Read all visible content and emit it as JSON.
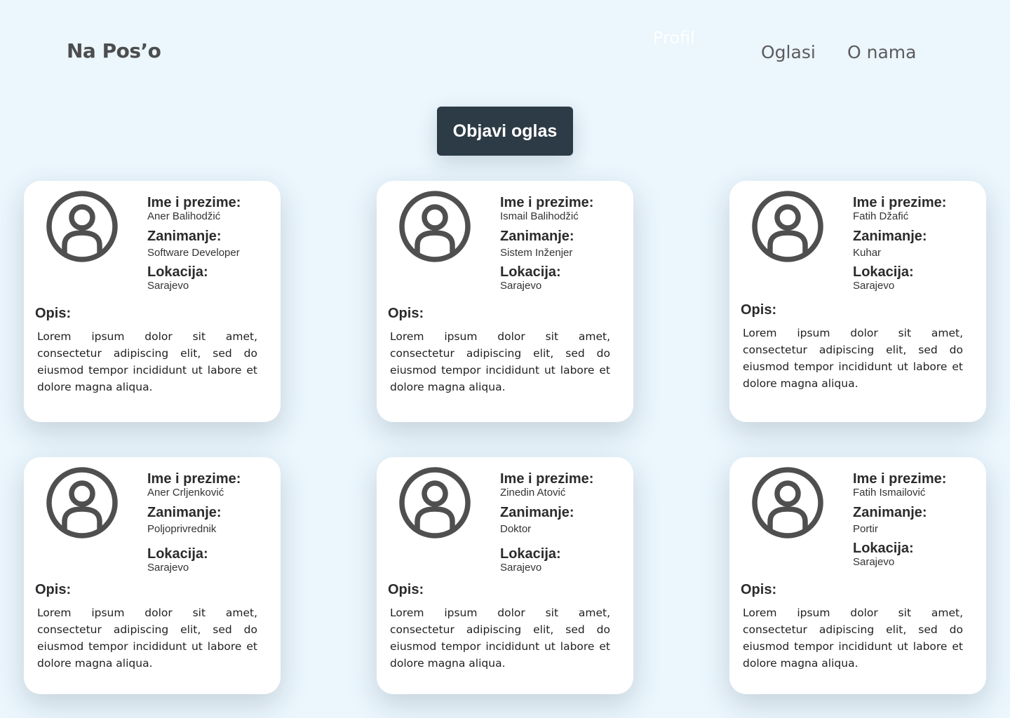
{
  "header": {
    "brand": "Na Pos’o",
    "nav": {
      "profil": "Profil",
      "oglasi": "Oglasi",
      "o_nama": "O nama"
    }
  },
  "cta": {
    "label": "Objavi oglas"
  },
  "labels": {
    "name": "Ime i prezime:",
    "occupation": "Zanimanje:",
    "location": "Lokacija:",
    "description": "Opis:"
  },
  "cards": [
    {
      "name": "Aner Balihodžić",
      "occupation": "Software Developer",
      "location": "Sarajevo",
      "description": "Lorem ipsum dolor sit amet, consectetur adipiscing elit, sed do eiusmod tempor incididunt ut labore et dolore magna aliqua."
    },
    {
      "name": "Ismail Balihodžić",
      "occupation": "Sistem Inženjer",
      "location": "Sarajevo",
      "description": "Lorem ipsum dolor sit amet, consectetur adipiscing elit, sed do eiusmod tempor incididunt ut labore et dolore magna aliqua."
    },
    {
      "name": "Fatih Džafić",
      "occupation": "Kuhar",
      "location": "Sarajevo",
      "description": "Lorem ipsum dolor sit amet, consectetur adipiscing elit, sed do eiusmod tempor incididunt ut labore et dolore magna aliqua."
    },
    {
      "name": "Aner Crljenković",
      "occupation": "Poljoprivrednik",
      "location": "Sarajevo",
      "description": "Lorem ipsum dolor sit amet, consectetur adipiscing elit, sed do eiusmod tempor incididunt ut labore et dolore magna aliqua."
    },
    {
      "name": "Zinedin Atović",
      "occupation": "Doktor",
      "location": "Sarajevo",
      "description": "Lorem ipsum dolor sit amet, consectetur adipiscing elit, sed do eiusmod tempor incididunt ut labore et dolore magna aliqua."
    },
    {
      "name": "Fatih Ismailović",
      "occupation": "Portir",
      "location": "Sarajevo",
      "description": "Lorem ipsum dolor sit amet, consectetur adipiscing elit, sed do eiusmod tempor incididunt ut labore et dolore magna aliqua."
    }
  ],
  "colors": {
    "background": "#ebf6fd",
    "button": "#2c3b45",
    "card": "#ffffff",
    "avatar": "#4f4f4f"
  },
  "icons": {
    "avatar": "user-circle-icon"
  }
}
